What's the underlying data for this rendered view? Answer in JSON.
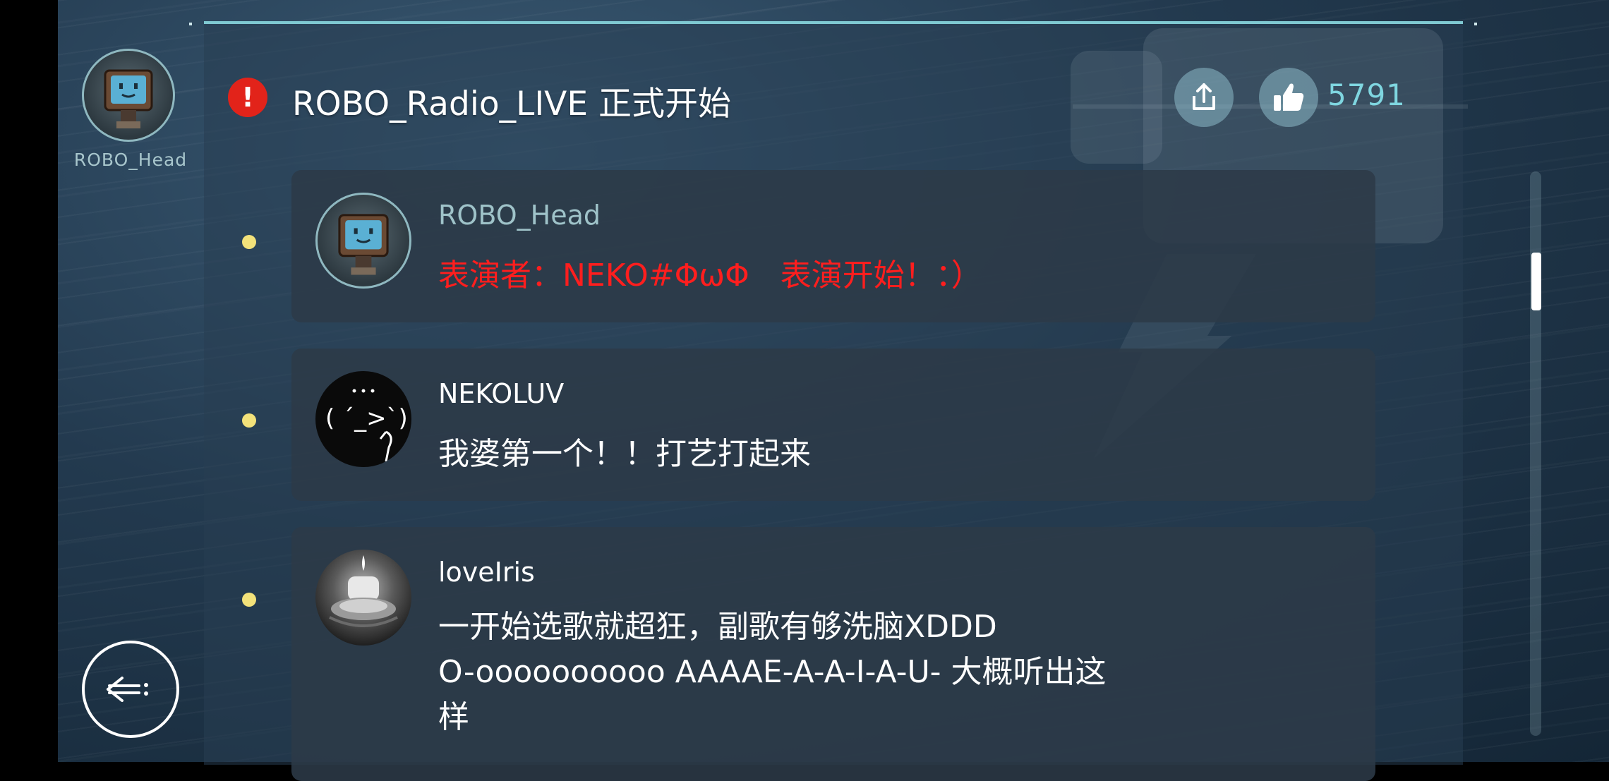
{
  "host": {
    "name": "ROBO_Head"
  },
  "header": {
    "title": "ROBO_Radio_LIVE 正式开始",
    "like_count": "5791"
  },
  "comments": [
    {
      "user": "ROBO_Head",
      "text": "表演者：NEKO#ΦωΦ　表演开始！：）",
      "text_color": "#ff1e1e",
      "name_color": "#9fc3c9"
    },
    {
      "user": "NEKOLUV",
      "text": "我婆第一个！！打艺打起来",
      "text_color": "#ffffff",
      "name_color": "#ffffff"
    },
    {
      "user": "loveIris",
      "text_lines": [
        "一开始选歌就超狂，副歌有够洗脑XDDD",
        "O-oooooooooo AAAAE-A-A-I-A-U- 大概听出这",
        "样"
      ],
      "text_color": "#ffffff",
      "name_color": "#ffffff"
    }
  ],
  "colors": {
    "accent": "#7fc9d2",
    "alert": "#e2231a",
    "bullet": "#f3e27a"
  },
  "icons": [
    "alert-icon",
    "share-icon",
    "thumbs-up-icon",
    "back-icon"
  ]
}
